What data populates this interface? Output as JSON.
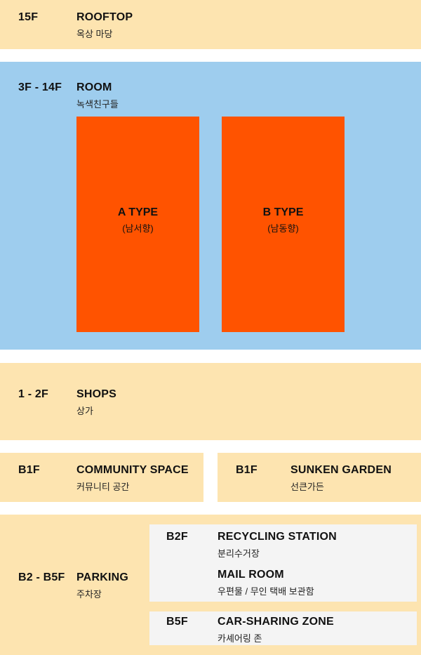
{
  "rooftop": {
    "floor": "15F",
    "title": "ROOFTOP",
    "subtitle": "옥상 마당"
  },
  "room": {
    "floor": "3F - 14F",
    "title": "ROOM",
    "subtitle": "녹색친구들",
    "types": [
      {
        "title": "A TYPE",
        "subtitle": "(남서향)"
      },
      {
        "title": "B TYPE",
        "subtitle": "(남동향)"
      }
    ]
  },
  "shops": {
    "floor": "1 - 2F",
    "title": "SHOPS",
    "subtitle": "상가"
  },
  "community": {
    "floor": "B1F",
    "title": "COMMUNITY SPACE",
    "subtitle": "커뮤니티 공간"
  },
  "sunken": {
    "floor": "B1F",
    "title": "SUNKEN GARDEN",
    "subtitle": "선큰가든"
  },
  "parking": {
    "floor": "B2 - B5F",
    "title": "PARKING",
    "subtitle": "주차장",
    "b2": {
      "floor": "B2F",
      "items": [
        {
          "title": "RECYCLING STATION",
          "subtitle": "분리수거장"
        },
        {
          "title": "MAIL ROOM",
          "subtitle": "우편물 / 무인 택배 보관함"
        }
      ]
    },
    "b5": {
      "floor": "B5F",
      "title": "CAR-SHARING ZONE",
      "subtitle": "카셰어링 존"
    }
  }
}
